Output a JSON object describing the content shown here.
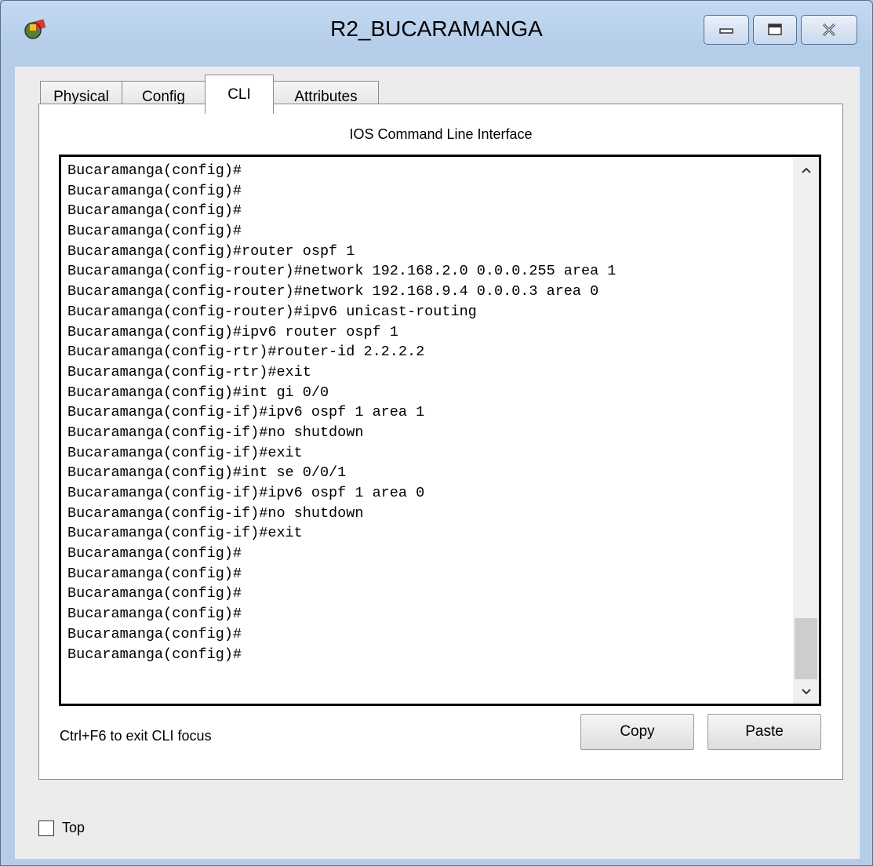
{
  "window": {
    "title": "R2_BUCARAMANGA",
    "icon": "packet-tracer-router-icon",
    "controls": [
      "minimize-icon",
      "maximize-icon",
      "close-icon"
    ]
  },
  "tabs": [
    {
      "label": "Physical",
      "active": false
    },
    {
      "label": "Config",
      "active": false
    },
    {
      "label": "CLI",
      "active": true
    },
    {
      "label": "Attributes",
      "active": false
    }
  ],
  "cli": {
    "heading": "IOS Command Line Interface",
    "lines": [
      "Bucaramanga(config)#",
      "Bucaramanga(config)#",
      "Bucaramanga(config)#",
      "Bucaramanga(config)#",
      "Bucaramanga(config)#router ospf 1",
      "Bucaramanga(config-router)#network 192.168.2.0 0.0.0.255 area 1",
      "Bucaramanga(config-router)#network 192.168.9.4 0.0.0.3 area 0",
      "Bucaramanga(config-router)#ipv6 unicast-routing",
      "Bucaramanga(config)#ipv6 router ospf 1",
      "Bucaramanga(config-rtr)#router-id 2.2.2.2",
      "Bucaramanga(config-rtr)#exit",
      "Bucaramanga(config)#int gi 0/0",
      "Bucaramanga(config-if)#ipv6 ospf 1 area 1",
      "Bucaramanga(config-if)#no shutdown",
      "Bucaramanga(config-if)#exit",
      "Bucaramanga(config)#int se 0/0/1",
      "Bucaramanga(config-if)#ipv6 ospf 1 area 0",
      "Bucaramanga(config-if)#no shutdown",
      "Bucaramanga(config-if)#exit",
      "Bucaramanga(config)#",
      "Bucaramanga(config)#",
      "Bucaramanga(config)#",
      "Bucaramanga(config)#",
      "Bucaramanga(config)#",
      "Bucaramanga(config)#"
    ],
    "focus_hint": "Ctrl+F6 to exit CLI focus",
    "copy_label": "Copy",
    "paste_label": "Paste"
  },
  "top_checkbox": {
    "label": "Top",
    "checked": false
  }
}
